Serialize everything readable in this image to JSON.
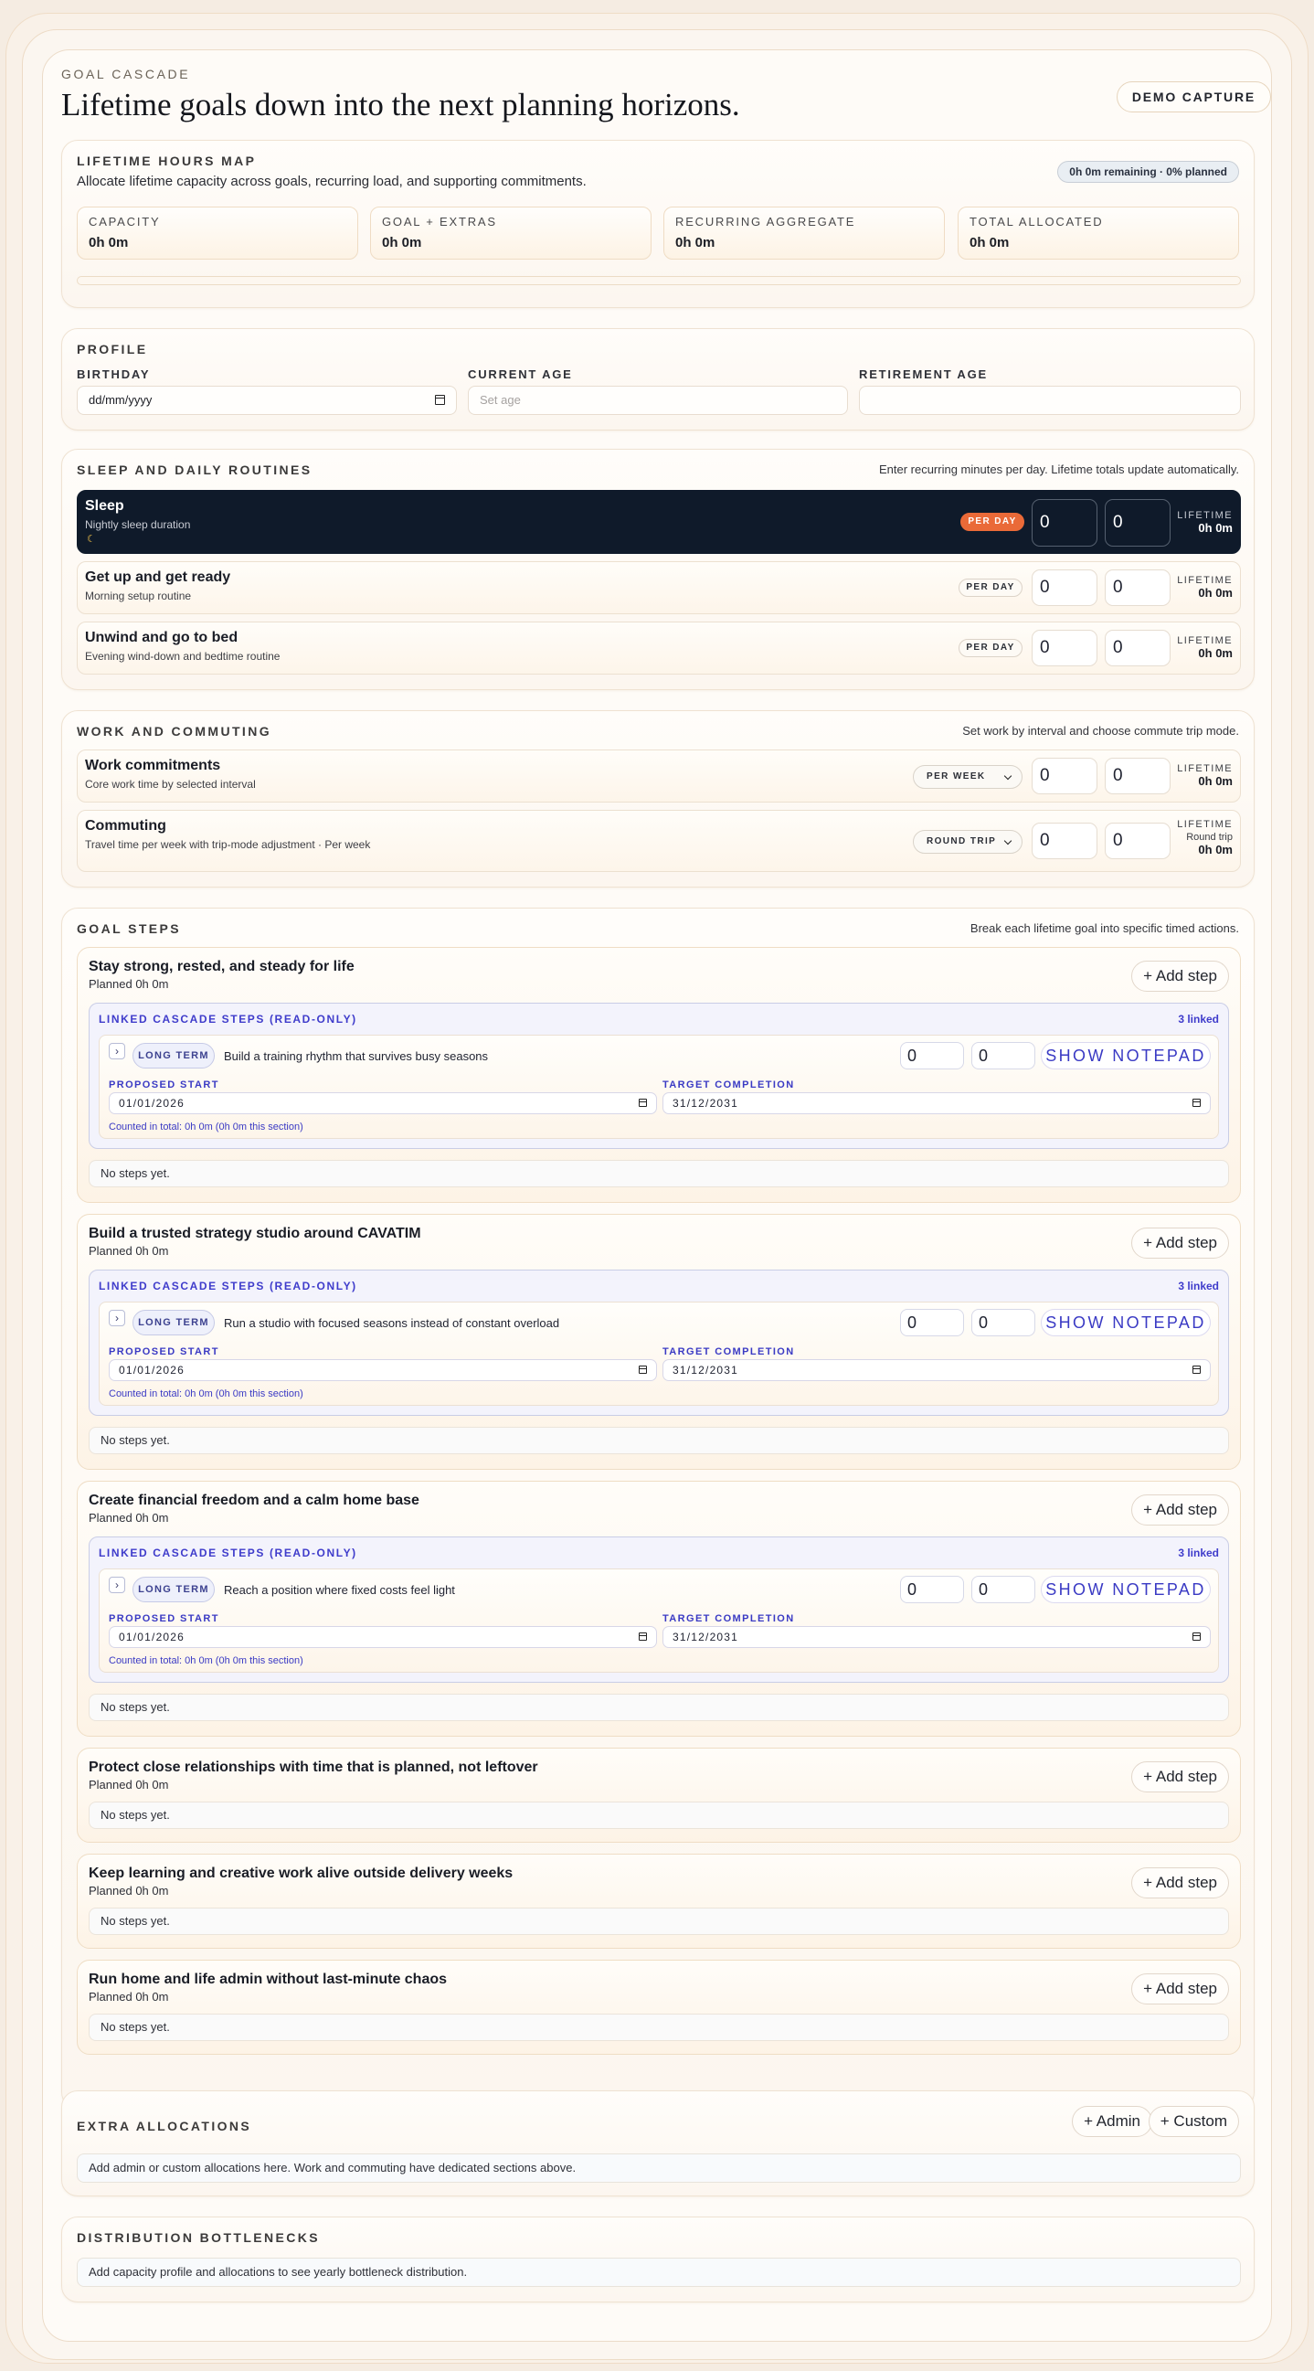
{
  "header": {
    "eyebrow": "GOAL CASCADE",
    "title": "Lifetime goals down into the next planning horizons.",
    "demo_button": "DEMO CAPTURE"
  },
  "hours_map": {
    "title": "LIFETIME HOURS MAP",
    "subtitle": "Allocate lifetime capacity across goals, recurring load, and supporting commitments.",
    "status": "0h 0m remaining · 0% planned",
    "progress_fraction": 0,
    "stats": [
      {
        "label": "CAPACITY",
        "value": "0h 0m"
      },
      {
        "label": "GOAL + EXTRAS",
        "value": "0h 0m"
      },
      {
        "label": "RECURRING AGGREGATE",
        "value": "0h 0m"
      },
      {
        "label": "TOTAL ALLOCATED",
        "value": "0h 0m"
      }
    ]
  },
  "profile": {
    "title": "PROFILE",
    "birthday_label": "BIRTHDAY",
    "birthday_value": "dd/mm/yyyy",
    "age_label": "CURRENT AGE",
    "age_placeholder": "Set age",
    "retirement_label": "RETIREMENT AGE",
    "retirement_value": ""
  },
  "sleep": {
    "title": "SLEEP AND DAILY ROUTINES",
    "note": "Enter recurring minutes per day. Lifetime totals update automatically.",
    "rows": [
      {
        "title": "Sleep",
        "desc": "Nightly sleep duration",
        "mode": "PER DAY",
        "v1": "0",
        "v2": "0",
        "lt_label": "LIFETIME",
        "lt_value": "0h 0m"
      },
      {
        "title": "Get up and get ready",
        "desc": "Morning setup routine",
        "mode": "PER DAY",
        "v1": "0",
        "v2": "0",
        "lt_label": "LIFETIME",
        "lt_value": "0h 0m"
      },
      {
        "title": "Unwind and go to bed",
        "desc": "Evening wind-down and bedtime routine",
        "mode": "PER DAY",
        "v1": "0",
        "v2": "0",
        "lt_label": "LIFETIME",
        "lt_value": "0h 0m"
      }
    ]
  },
  "work": {
    "title": "WORK AND COMMUTING",
    "note": "Set work by interval and choose commute trip mode.",
    "rows": [
      {
        "title": "Work commitments",
        "desc": "Core work time by selected interval",
        "mode": "PER WEEK",
        "v1": "0",
        "v2": "0",
        "lt_label": "LIFETIME",
        "lt_value": "0h 0m"
      },
      {
        "title": "Commuting",
        "desc": "Travel time per week with trip-mode adjustment · Per week",
        "mode": "ROUND TRIP",
        "v1": "0",
        "v2": "0",
        "lt_label": "LIFETIME",
        "lt_sub": "Round trip",
        "lt_value": "0h 0m"
      }
    ]
  },
  "goal_steps": {
    "title": "GOAL STEPS",
    "note": "Break each lifetime goal into specific timed actions.",
    "add_step_label": "+ Add step",
    "no_steps": "No steps yet.",
    "linked_title": "LINKED CASCADE STEPS (READ-ONLY)",
    "linked_count": "3 linked",
    "term_label": "LONG TERM",
    "start_label": "PROPOSED START",
    "target_label": "TARGET COMPLETION",
    "notepad_label": "SHOW NOTEPAD",
    "goals": [
      {
        "title": "Stay strong, rested, and steady for life",
        "planned": "Planned 0h 0m",
        "linked_step": "Build a training rhythm that survives busy seasons",
        "v1": "0",
        "v2": "0",
        "start": "01/01/2026",
        "target": "31/12/2031",
        "counted": "Counted in total: 0h 0m (0h 0m this section)"
      },
      {
        "title": "Build a trusted strategy studio around CAVATIM",
        "planned": "Planned 0h 0m",
        "linked_step": "Run a studio with focused seasons instead of constant overload",
        "v1": "0",
        "v2": "0",
        "start": "01/01/2026",
        "target": "31/12/2031",
        "counted": "Counted in total: 0h 0m (0h 0m this section)"
      },
      {
        "title": "Create financial freedom and a calm home base",
        "planned": "Planned 0h 0m",
        "linked_step": "Reach a position where fixed costs feel light",
        "v1": "0",
        "v2": "0",
        "start": "01/01/2026",
        "target": "31/12/2031",
        "counted": "Counted in total: 0h 0m (0h 0m this section)"
      },
      {
        "title": "Protect close relationships with time that is planned, not leftover",
        "planned": "Planned 0h 0m"
      },
      {
        "title": "Keep learning and creative work alive outside delivery weeks",
        "planned": "Planned 0h 0m"
      },
      {
        "title": "Run home and life admin without last-minute chaos",
        "planned": "Planned 0h 0m"
      }
    ]
  },
  "extra": {
    "title": "EXTRA ALLOCATIONS",
    "admin_button": "+ Admin",
    "custom_button": "+ Custom",
    "message": "Add admin or custom allocations here. Work and commuting have dedicated sections above."
  },
  "bottlenecks": {
    "title": "DISTRIBUTION BOTTLENECKS",
    "message": "Add capacity profile and allocations to see yearly bottleneck distribution."
  }
}
